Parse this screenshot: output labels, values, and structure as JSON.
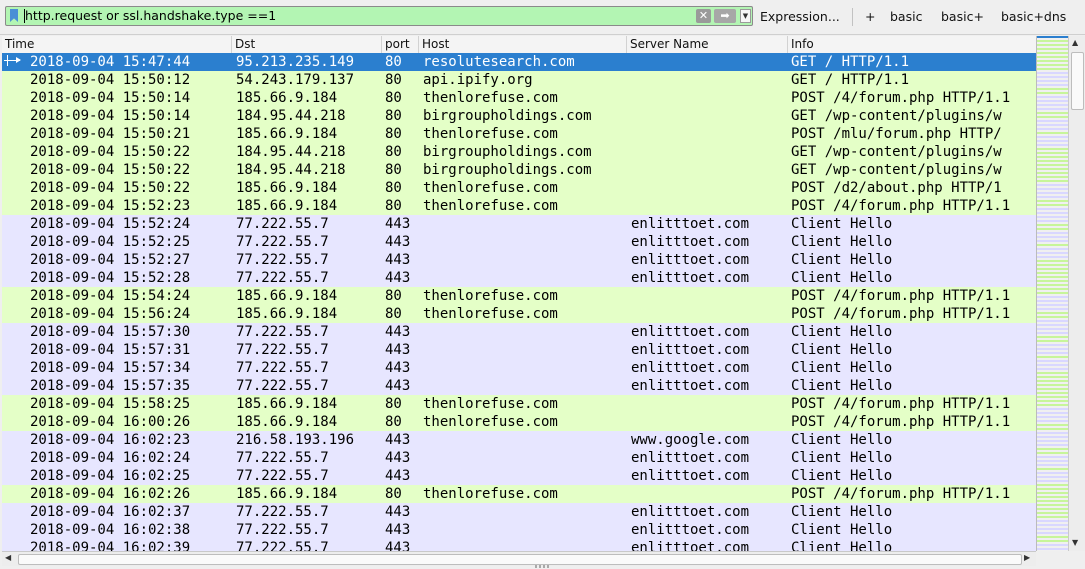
{
  "filter": {
    "value": "http.request or ssl.handshake.type ==1",
    "clear_icon": "clear-x-icon",
    "apply_icon": "arrow-right-icon"
  },
  "toolbar": {
    "expression_label": "Expression...",
    "add_label": "+",
    "buttons": [
      "basic",
      "basic+",
      "basic+dns"
    ]
  },
  "columns": {
    "time": "Time",
    "dst": "Dst",
    "port": "port",
    "host": "Host",
    "server": "Server Name",
    "info": "Info"
  },
  "colors": {
    "http_row": "#e4ffc7",
    "tls_row": "#e7e6ff",
    "selected_row": "#2b7fcf",
    "filter_valid": "#b3f5b3"
  },
  "rows": [
    {
      "time": "2018-09-04 15:47:44",
      "dst": "95.213.235.149",
      "port": "80",
      "host": "resolutesearch.com",
      "server": "",
      "info": "GET / HTTP/1.1",
      "kind": "http",
      "selected": true
    },
    {
      "time": "2018-09-04 15:50:12",
      "dst": "54.243.179.137",
      "port": "80",
      "host": "api.ipify.org",
      "server": "",
      "info": "GET / HTTP/1.1",
      "kind": "http"
    },
    {
      "time": "2018-09-04 15:50:14",
      "dst": "185.66.9.184",
      "port": "80",
      "host": "thenlorefuse.com",
      "server": "",
      "info": "POST /4/forum.php HTTP/1.1",
      "kind": "http"
    },
    {
      "time": "2018-09-04 15:50:14",
      "dst": "184.95.44.218",
      "port": "80",
      "host": "birgroupholdings.com",
      "server": "",
      "info": "GET /wp-content/plugins/w",
      "kind": "http"
    },
    {
      "time": "2018-09-04 15:50:21",
      "dst": "185.66.9.184",
      "port": "80",
      "host": "thenlorefuse.com",
      "server": "",
      "info": "POST /mlu/forum.php HTTP/",
      "kind": "http"
    },
    {
      "time": "2018-09-04 15:50:22",
      "dst": "184.95.44.218",
      "port": "80",
      "host": "birgroupholdings.com",
      "server": "",
      "info": "GET /wp-content/plugins/w",
      "kind": "http"
    },
    {
      "time": "2018-09-04 15:50:22",
      "dst": "184.95.44.218",
      "port": "80",
      "host": "birgroupholdings.com",
      "server": "",
      "info": "GET /wp-content/plugins/w",
      "kind": "http"
    },
    {
      "time": "2018-09-04 15:50:22",
      "dst": "185.66.9.184",
      "port": "80",
      "host": "thenlorefuse.com",
      "server": "",
      "info": "POST /d2/about.php HTTP/1",
      "kind": "http"
    },
    {
      "time": "2018-09-04 15:52:23",
      "dst": "185.66.9.184",
      "port": "80",
      "host": "thenlorefuse.com",
      "server": "",
      "info": "POST /4/forum.php HTTP/1.1",
      "kind": "http"
    },
    {
      "time": "2018-09-04 15:52:24",
      "dst": "77.222.55.7",
      "port": "443",
      "host": "",
      "server": "enlitttoet.com",
      "info": "Client Hello",
      "kind": "tls"
    },
    {
      "time": "2018-09-04 15:52:25",
      "dst": "77.222.55.7",
      "port": "443",
      "host": "",
      "server": "enlitttoet.com",
      "info": "Client Hello",
      "kind": "tls"
    },
    {
      "time": "2018-09-04 15:52:27",
      "dst": "77.222.55.7",
      "port": "443",
      "host": "",
      "server": "enlitttoet.com",
      "info": "Client Hello",
      "kind": "tls"
    },
    {
      "time": "2018-09-04 15:52:28",
      "dst": "77.222.55.7",
      "port": "443",
      "host": "",
      "server": "enlitttoet.com",
      "info": "Client Hello",
      "kind": "tls"
    },
    {
      "time": "2018-09-04 15:54:24",
      "dst": "185.66.9.184",
      "port": "80",
      "host": "thenlorefuse.com",
      "server": "",
      "info": "POST /4/forum.php HTTP/1.1",
      "kind": "http"
    },
    {
      "time": "2018-09-04 15:56:24",
      "dst": "185.66.9.184",
      "port": "80",
      "host": "thenlorefuse.com",
      "server": "",
      "info": "POST /4/forum.php HTTP/1.1",
      "kind": "http"
    },
    {
      "time": "2018-09-04 15:57:30",
      "dst": "77.222.55.7",
      "port": "443",
      "host": "",
      "server": "enlitttoet.com",
      "info": "Client Hello",
      "kind": "tls"
    },
    {
      "time": "2018-09-04 15:57:31",
      "dst": "77.222.55.7",
      "port": "443",
      "host": "",
      "server": "enlitttoet.com",
      "info": "Client Hello",
      "kind": "tls"
    },
    {
      "time": "2018-09-04 15:57:34",
      "dst": "77.222.55.7",
      "port": "443",
      "host": "",
      "server": "enlitttoet.com",
      "info": "Client Hello",
      "kind": "tls"
    },
    {
      "time": "2018-09-04 15:57:35",
      "dst": "77.222.55.7",
      "port": "443",
      "host": "",
      "server": "enlitttoet.com",
      "info": "Client Hello",
      "kind": "tls"
    },
    {
      "time": "2018-09-04 15:58:25",
      "dst": "185.66.9.184",
      "port": "80",
      "host": "thenlorefuse.com",
      "server": "",
      "info": "POST /4/forum.php HTTP/1.1",
      "kind": "http"
    },
    {
      "time": "2018-09-04 16:00:26",
      "dst": "185.66.9.184",
      "port": "80",
      "host": "thenlorefuse.com",
      "server": "",
      "info": "POST /4/forum.php HTTP/1.1",
      "kind": "http"
    },
    {
      "time": "2018-09-04 16:02:23",
      "dst": "216.58.193.196",
      "port": "443",
      "host": "",
      "server": "www.google.com",
      "info": "Client Hello",
      "kind": "tls"
    },
    {
      "time": "2018-09-04 16:02:24",
      "dst": "77.222.55.7",
      "port": "443",
      "host": "",
      "server": "enlitttoet.com",
      "info": "Client Hello",
      "kind": "tls"
    },
    {
      "time": "2018-09-04 16:02:25",
      "dst": "77.222.55.7",
      "port": "443",
      "host": "",
      "server": "enlitttoet.com",
      "info": "Client Hello",
      "kind": "tls"
    },
    {
      "time": "2018-09-04 16:02:26",
      "dst": "185.66.9.184",
      "port": "80",
      "host": "thenlorefuse.com",
      "server": "",
      "info": "POST /4/forum.php HTTP/1.1",
      "kind": "http"
    },
    {
      "time": "2018-09-04 16:02:37",
      "dst": "77.222.55.7",
      "port": "443",
      "host": "",
      "server": "enlitttoet.com",
      "info": "Client Hello",
      "kind": "tls"
    },
    {
      "time": "2018-09-04 16:02:38",
      "dst": "77.222.55.7",
      "port": "443",
      "host": "",
      "server": "enlitttoet.com",
      "info": "Client Hello",
      "kind": "tls"
    },
    {
      "time": "2018-09-04 16:02:39",
      "dst": "77.222.55.7",
      "port": "443",
      "host": "",
      "server": "enlitttoet.com",
      "info": "Client Hello",
      "kind": "tls"
    }
  ]
}
